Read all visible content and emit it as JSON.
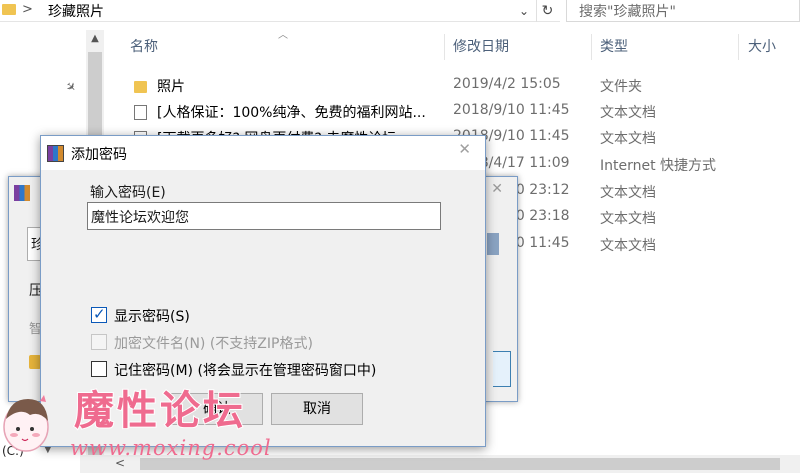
{
  "explorer": {
    "address": {
      "chevron": ">",
      "path": "珍藏照片",
      "dropdown": "⌄",
      "refresh": "↻"
    },
    "search_placeholder": "搜索\"珍藏照片\"",
    "columns": {
      "name": "名称",
      "date": "修改日期",
      "type": "类型",
      "size": "大小"
    },
    "files": [
      {
        "name": "照片",
        "date": "2019/4/2 15:05",
        "type": "文件夹",
        "icon": "folder-icon"
      },
      {
        "name": "[人格保证：100%纯净、免费的福利网站...",
        "date": "2018/9/10 11:45",
        "type": "文本文档",
        "icon": "document-icon"
      },
      {
        "name": "[下载更多好? 网盘更付费? 去魔性论坛...",
        "date": "2018/9/10 11:45",
        "type": "文本文档",
        "icon": "document-icon"
      },
      {
        "name": "",
        "date": "2018/4/17 11:09",
        "type": "Internet 快捷方式",
        "icon": "shortcut-icon"
      },
      {
        "name": "",
        "date": "2018/9/10 23:12",
        "type": "文本文档",
        "icon": "document-icon"
      },
      {
        "name": "",
        "date": "2018/9/10 23:18",
        "type": "文本文档",
        "icon": "document-icon"
      },
      {
        "name": "",
        "date": "2018/9/10 11:45",
        "type": "文本文档",
        "icon": "document-icon"
      }
    ],
    "drive_label": "(C:)"
  },
  "back_dialog": {
    "field_char": "珍",
    "label1": "压",
    "label2": "智"
  },
  "dialog": {
    "title": "添加密码",
    "password_label": "输入密码(E)",
    "password_value": "魔性论坛欢迎您",
    "options": [
      {
        "label": "显示密码(S)",
        "checked": true,
        "enabled": true
      },
      {
        "label": "加密文件名(N) (不支持ZIP格式)",
        "checked": false,
        "enabled": false
      },
      {
        "label": "记住密码(M) (将会显示在管理密码窗口中)",
        "checked": false,
        "enabled": true
      }
    ],
    "ok_label": "确认",
    "cancel_label": "取消"
  },
  "watermark": {
    "title": "魔性论坛",
    "url": "www.moxing.cool",
    "accent_color": "#ef6b8f"
  }
}
